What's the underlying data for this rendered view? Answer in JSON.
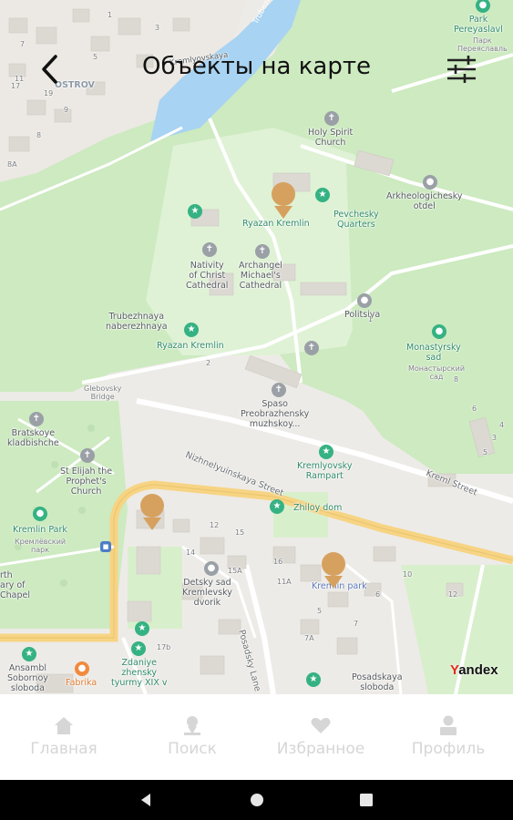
{
  "header": {
    "title": "Объекты на карте"
  },
  "map": {
    "labels": {
      "kremlyovskaya": "Kremlyovskaya",
      "trubezh": "Trubezh",
      "ostrov": "OSTROV",
      "park_pereyaslav": "Park\nPereyaslavl",
      "park_pereyaslav_ru": "Парк\nПереяславль",
      "holy_spirit": "Holy Spirit\nChurch",
      "arkheolog": "Arkheologichesky\notdel",
      "ryazan_kremlin_top": "Ryazan Kremlin",
      "pevchesky": "Pevchesky\nQuarters",
      "nativity": "Nativity\nof Christ\nCathedral",
      "archangel": "Archangel\nMichael's\nCathedral",
      "trubezhnaya": "Trubezhnaya\nnaberezhnaya",
      "ryazan_kremlin_mid": "Ryazan Kremlin",
      "politsiya": "Politsiya",
      "monastyrsky": "Monastyrsky\nsad",
      "monastyrsky_ru": "Монастырский\nсад",
      "glebovsky": "Glebovsky\nBridge",
      "spaso": "Spaso\nPreobrazhensky\nmuzhskoy...",
      "bratskoye": "Bratskoye\nkladbishche",
      "st_elijah": "St Elijah the\nProphet's\nChurch",
      "nizhne_street": "Nizhnelyuinskaya Street",
      "kremlevsky_rampart": "Kremlyovsky\nRampart",
      "kreml_street": "Kreml Street",
      "kremlin_park": "Kremlin Park",
      "kremlin_park_ru": "Кремлёвский\nпарк",
      "zhiloy_dom": "Zhiloy dom",
      "chapel": "rth\nary of\nChapel",
      "detsky_sad": "Detsky sad\nKremlevsky\ndvorik",
      "kremlin_park2": "Kremlin park",
      "posadsky_lane": "Posadsky Lane",
      "ansambl": "Ansambl\nSobornoy\nsloboda",
      "fabrika": "Fabrika",
      "zdaniye": "Zdaniye\nzhensky\ntyurmy XIX v",
      "posadskaya": "Posadskaya\nsloboda"
    },
    "house_numbers": [
      "1",
      "3",
      "5",
      "7",
      "9",
      "11",
      "17",
      "19",
      "8",
      "8A",
      "12",
      "14",
      "15",
      "15A",
      "16",
      "11A",
      "5",
      "7",
      "7A",
      "6",
      "10",
      "17b",
      "12",
      "3",
      "4",
      "5",
      "6",
      "8",
      "2",
      "1"
    ],
    "attribution_y": "Y",
    "attribution_rest": "andex"
  },
  "icons": {
    "back": "back-arrow-icon",
    "filter": "filter-sliders-icon",
    "home": "home-icon",
    "search": "search-icon",
    "favorites": "heart-icon",
    "profile": "profile-icon"
  },
  "tabs": [
    {
      "label": "Главная"
    },
    {
      "label": "Поиск"
    },
    {
      "label": "Избранное"
    },
    {
      "label": "Профиль"
    }
  ],
  "colors": {
    "marker": "#d6a15f",
    "tab_inactive": "#d6d6d6",
    "park_green": "#cdeac0",
    "water": "#a8d3f2",
    "main_road": "#f7d483"
  }
}
